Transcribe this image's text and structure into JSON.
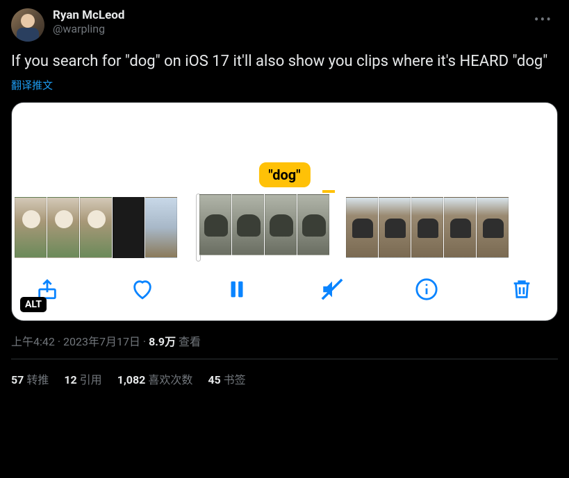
{
  "author": {
    "display_name": "Ryan McLeod",
    "handle": "@warpling"
  },
  "tweet_text": "If you search for \"dog\" on iOS 17 it'll also show you clips where it's HEARD \"dog\"",
  "translate_label": "翻译推文",
  "media": {
    "caption_pill": "\"dog\"",
    "alt_badge": "ALT"
  },
  "meta": {
    "time": "上午4:42",
    "date": "2023年7月17日",
    "views_count": "8.9万",
    "views_label": "查看"
  },
  "stats": {
    "retweets_count": "57",
    "retweets_label": "转推",
    "quotes_count": "12",
    "quotes_label": "引用",
    "likes_count": "1,082",
    "likes_label": "喜欢次数",
    "bookmarks_count": "45",
    "bookmarks_label": "书签"
  }
}
